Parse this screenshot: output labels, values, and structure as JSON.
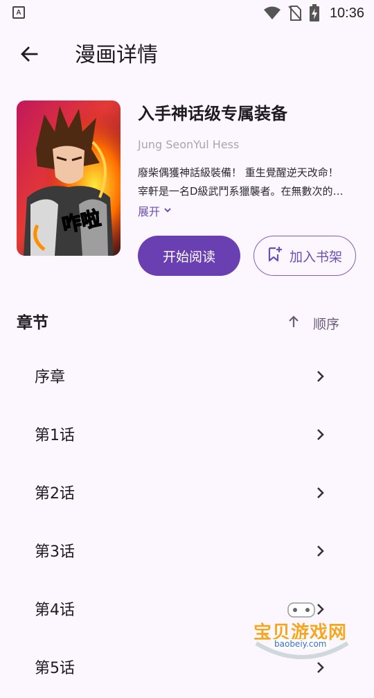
{
  "status_bar": {
    "time": "10:36",
    "left_icon_letter": "A"
  },
  "app_bar": {
    "title": "漫画详情"
  },
  "comic": {
    "title": "入手神话级专属装备",
    "author": "Jung SeonYul Hess",
    "description": "廢柴偶獲神話級裝備！ 重生覺醒逆天改命！ 宰軒是一名D級武鬥系獵襲者。在無數次的生死搏鬥中終於獲得了神話級的專屬裝備……",
    "expand_label": "展开",
    "cover_text": "咋啦"
  },
  "actions": {
    "start_reading": "开始阅读",
    "add_to_shelf": "加入书架"
  },
  "chapters": {
    "title": "章节",
    "sort_label": "顺序",
    "items": [
      {
        "label": "序章"
      },
      {
        "label": "第1话"
      },
      {
        "label": "第2话"
      },
      {
        "label": "第3话"
      },
      {
        "label": "第4话"
      },
      {
        "label": "第5话"
      }
    ]
  },
  "watermark": {
    "text": "宝贝游戏网",
    "url": "baobeiy.com"
  },
  "colors": {
    "primary": "#6A3FB2",
    "background": "#FCF7FE",
    "accent_text": "#6B4FB5"
  }
}
